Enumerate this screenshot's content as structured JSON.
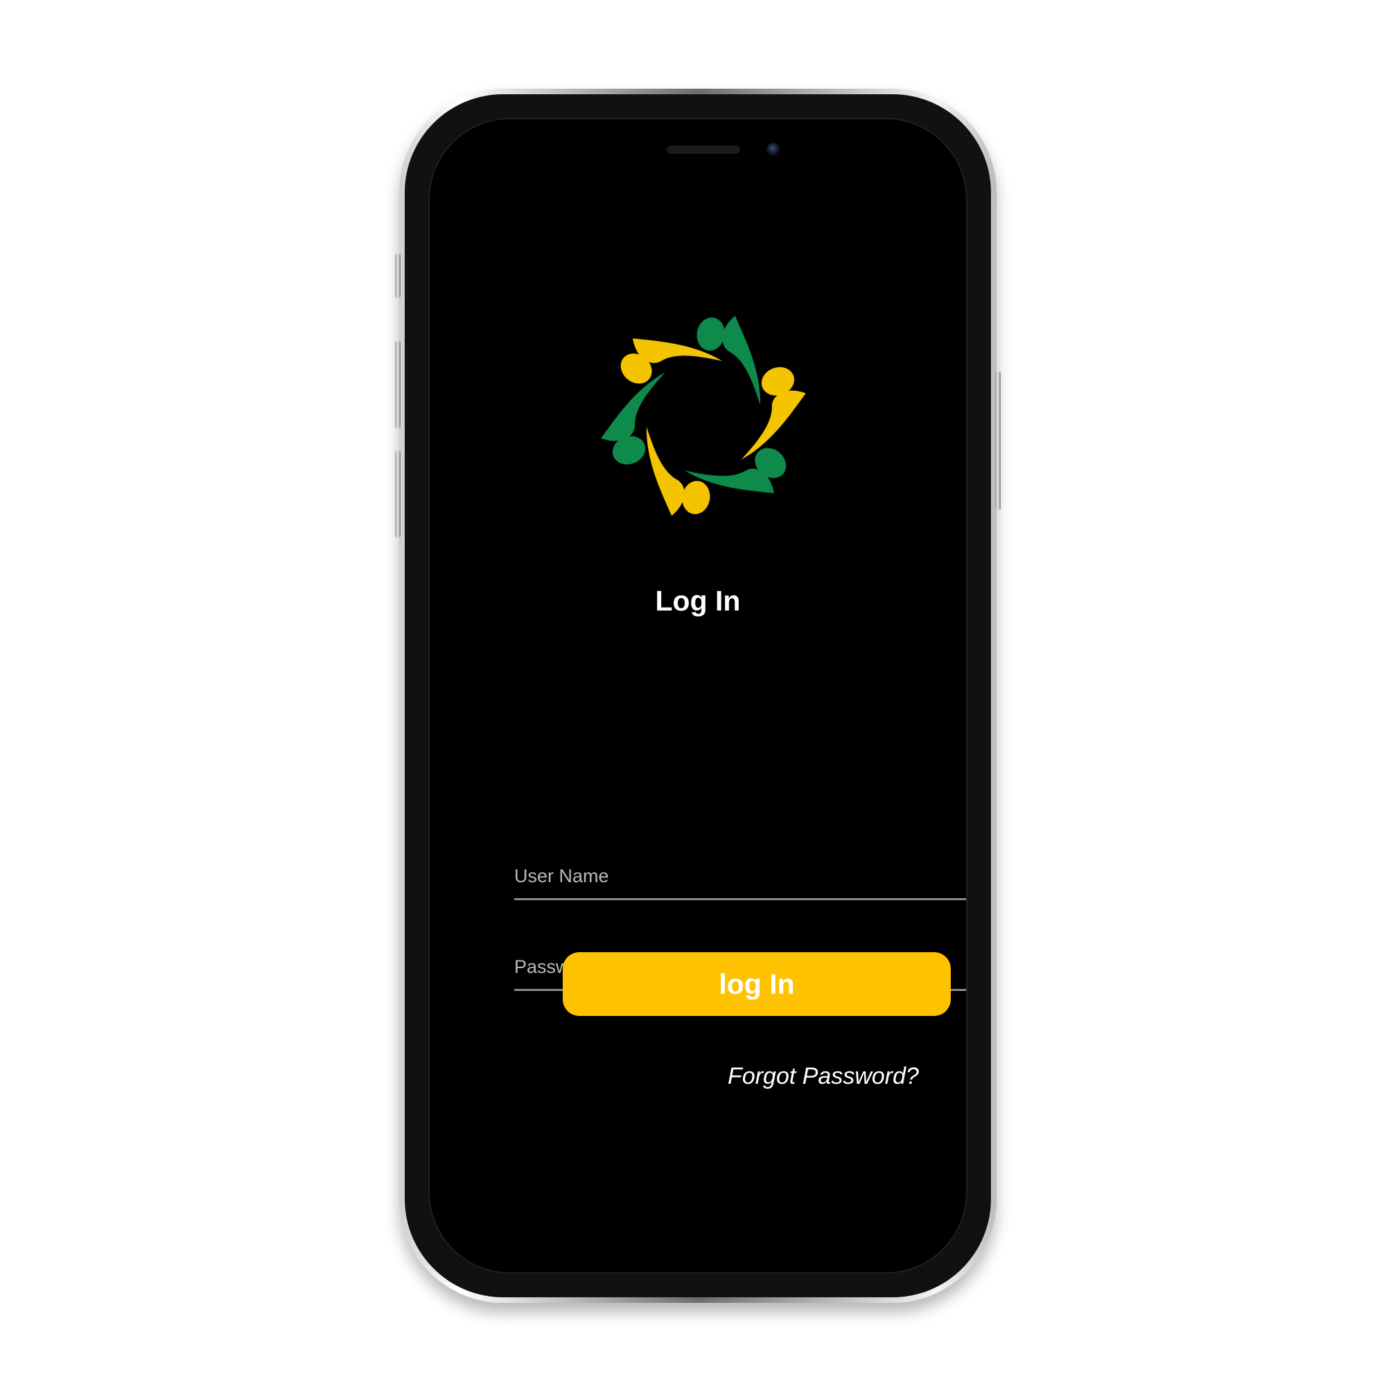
{
  "device": {
    "type": "iPhone mockup"
  },
  "brand": {
    "logo_icon": "community-circle-logo-icon",
    "colors": {
      "yellow": "#F5C400",
      "green": "#0E8A4A",
      "button": "#FFC200",
      "screen_bg": "#000000"
    }
  },
  "login": {
    "title": "Log In",
    "username_placeholder": "User Name",
    "password_placeholder": "Password",
    "submit_label": "log In",
    "forgot_label": "Forgot Password?"
  }
}
